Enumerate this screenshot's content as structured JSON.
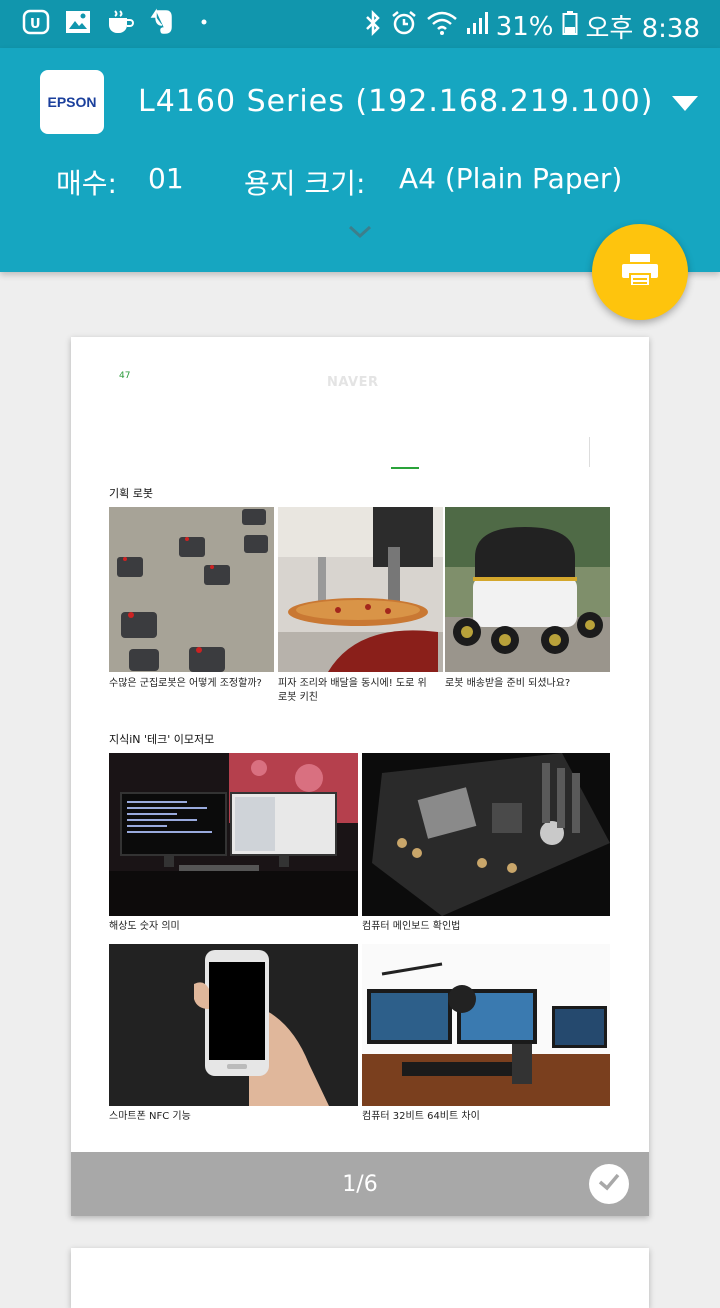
{
  "status_bar": {
    "battery": "31%",
    "time": "오후 8:38",
    "left_icons": [
      "u-plus-icon",
      "gallery-icon",
      "coffee-icon",
      "evernote-icon",
      "dot-icon"
    ],
    "right_icons": [
      "bluetooth-icon",
      "alarm-icon",
      "wifi-icon",
      "signal-icon",
      "battery-icon"
    ]
  },
  "header": {
    "logo_text": "EPSON",
    "printer_name": "L4160 Series (192.168.219.100)",
    "copies_label": "매수:",
    "copies_value": "01",
    "paper_label": "용지 크기:",
    "paper_value": "A4 (Plain Paper)"
  },
  "preview": {
    "page_number_small": "47",
    "brand": "NAVER",
    "section1_title": "기획  로봇",
    "section1_items": [
      {
        "caption": "수많은 군집로봇은 어떻게 조정할까?"
      },
      {
        "caption": "피자 조리와 배달을 동시에! 도로 위 로봇 키친"
      },
      {
        "caption": "로봇 배송받을 준비 되셨나요?"
      }
    ],
    "section2_title": "지식iN  '테크' 이모저모",
    "section2_items": [
      {
        "caption": "해상도 숫자 의미"
      },
      {
        "caption": "컴퓨터 메인보드 확인법"
      },
      {
        "caption": "스마트폰 NFC 기능"
      },
      {
        "caption": "컴퓨터 32비트 64비트 차이"
      }
    ],
    "page_counter": "1/6"
  },
  "colors": {
    "status_bar": "#1196ad",
    "header": "#16a6c1",
    "fab": "#fec40d",
    "page_footer": "#a8a8a8"
  }
}
